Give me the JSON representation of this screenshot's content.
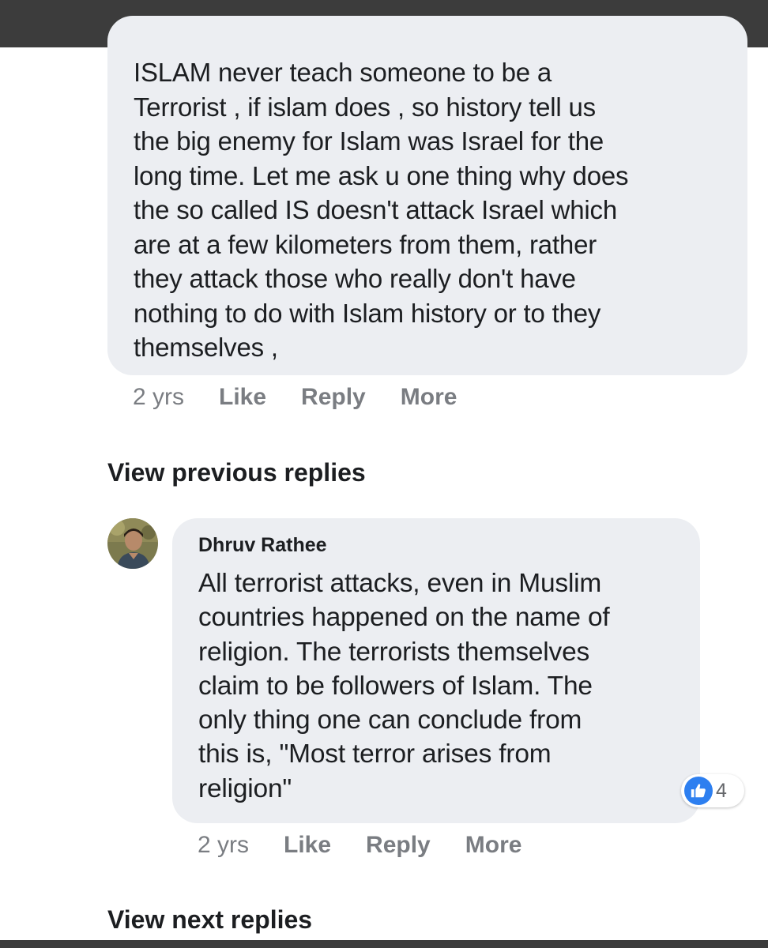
{
  "comment1": {
    "text": "ISLAM never teach someone to be a\nTerrorist , if islam does , so history tell us\nthe big enemy for Islam was Israel for the\nlong time. Let me ask u one thing why does\nthe so called IS doesn't attack Israel which\nare at a few kilometers from them, rather\nthey attack those who really don't have\nnothing to do with Islam history or to they\nthemselves ,",
    "time": "2 yrs",
    "like_label": "Like",
    "reply_label": "Reply",
    "more_label": "More"
  },
  "view_previous_label": "View previous replies",
  "comment2": {
    "author": "Dhruv Rathee",
    "text": "All terrorist attacks, even in Muslim\ncountries happened on the name of\nreligion. The terrorists themselves\nclaim to be followers of Islam. The\nonly thing one can conclude from\nthis is, \"Most terror arises from\nreligion\"",
    "reaction_count": "4",
    "time": "2 yrs",
    "like_label": "Like",
    "reply_label": "Reply",
    "more_label": "More"
  },
  "view_next_label": "View next replies",
  "colors": {
    "bubble": "#eceef2",
    "like_blue": "#2d7ff0",
    "muted_text": "#7a7d82",
    "top_bar": "#3c3c3c"
  },
  "icons": {
    "reaction": "thumbs-up-icon",
    "avatar": "user-avatar"
  }
}
